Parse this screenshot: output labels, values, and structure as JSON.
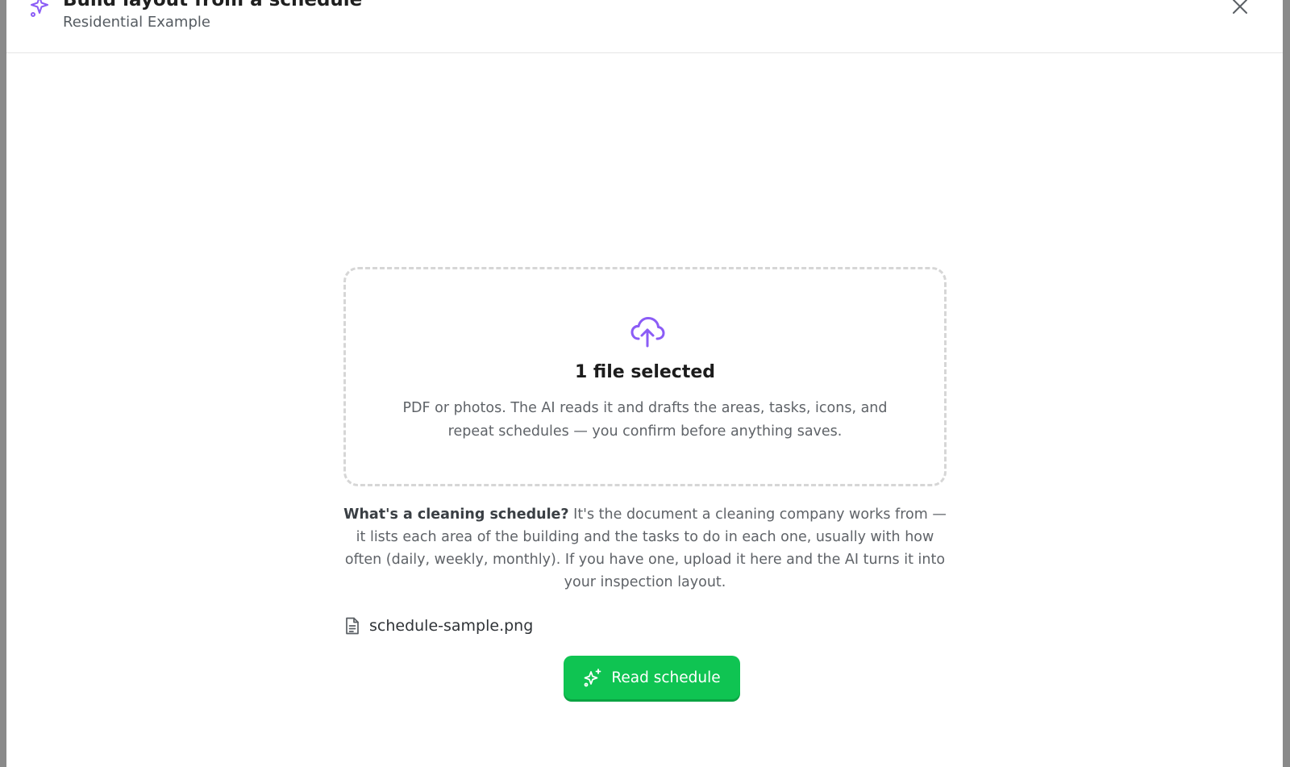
{
  "modal": {
    "title": "Build layout from a schedule",
    "subtitle": "Residential Example",
    "header_icon": "sparkles-icon",
    "close_icon": "close-icon"
  },
  "dropzone": {
    "icon": "cloud-upload-icon",
    "title": "1 file selected",
    "description": "PDF or photos. The AI reads it and drafts the areas, tasks, icons, and repeat schedules — you confirm before anything saves."
  },
  "explainer": {
    "bold": "What's a cleaning schedule?",
    "text": " It's the document a cleaning company works from — it lists each area of the building and the tasks to do in each one, usually with how often (daily, weekly, monthly). If you have one, upload it here and the AI turns it into your inspection layout."
  },
  "file": {
    "icon": "file-icon",
    "name": "schedule-sample.png"
  },
  "read_button": {
    "label": "Read schedule",
    "icon": "sparkles-icon"
  },
  "colors": {
    "accent": "#8b5cf6",
    "button_green": "#0fc452",
    "backdrop": "#8a8a8a"
  }
}
